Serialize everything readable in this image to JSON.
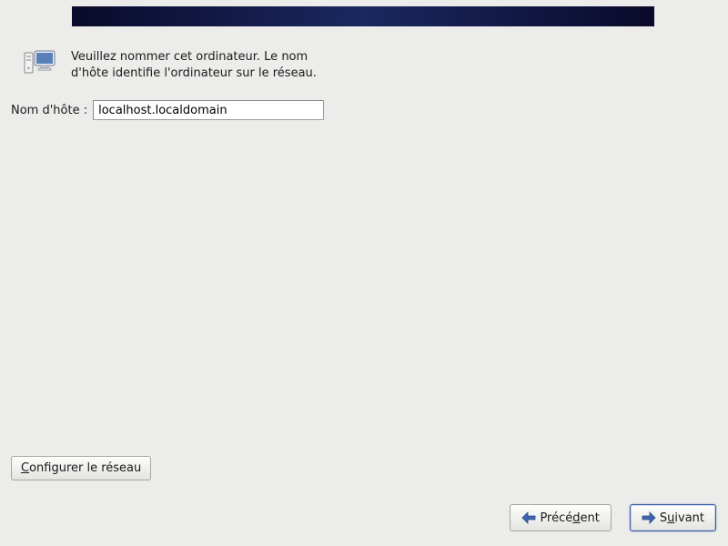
{
  "header": {
    "description_line1": "Veuillez nommer cet ordinateur.  Le nom",
    "description_line2": "d'hôte identifie l'ordinateur sur le réseau."
  },
  "form": {
    "hostname_label": "Nom d'hôte :",
    "hostname_value": "localhost.localdomain"
  },
  "buttons": {
    "configure_network_pre": "",
    "configure_network_u": "C",
    "configure_network_post": "onfigurer le réseau",
    "back_pre": "Précé",
    "back_u": "d",
    "back_post": "ent",
    "next_pre": "S",
    "next_u": "u",
    "next_post": "ivant"
  },
  "icons": {
    "network": "network-computers-icon",
    "arrow_left": "arrow-left-icon",
    "arrow_right": "arrow-right-icon"
  }
}
